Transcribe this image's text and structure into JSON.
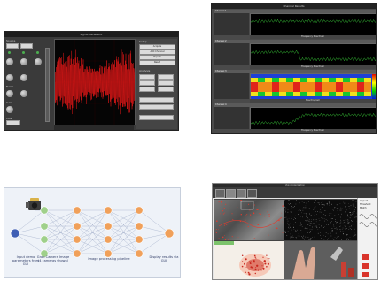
{
  "signal_generator": {
    "title": "Signal Generator",
    "left_labels": [
      "Source",
      "Noise",
      "Gain",
      "Filter"
    ],
    "right_buttons": [
      "Acquire",
      "Add Channel",
      "Export",
      "Reset"
    ],
    "right_headers": [
      "Setup",
      "Analysis"
    ],
    "colors": {
      "background": "#3a3a3a",
      "trace": "#ff1a1a",
      "panel": "#454545"
    }
  },
  "channel_results": {
    "title": "Channel Results",
    "rows": [
      {
        "header": "Channel 1",
        "caption": "Frequency Spectrum"
      },
      {
        "header": "Channel 2",
        "caption": "Frequency Spectrum"
      },
      {
        "header": "Channel 3",
        "caption": "Spectrogram"
      },
      {
        "header": "Channel 4",
        "caption": "Frequency Spectrum"
      }
    ],
    "colors": {
      "trace": "#3ddc3d",
      "background": "#4a4a4a"
    }
  },
  "pipeline": {
    "labels": {
      "input": "Input demo parameters from GUI",
      "grab": "Grab Camera Image (4 cameras shown)",
      "process": "Image processing pipeline",
      "display": "Display results via GUI"
    },
    "colors": {
      "input": "#3f5fb5",
      "stage": "#9fd08a",
      "node": "#f0a05a",
      "background": "#eef2f8"
    }
  },
  "vision_app": {
    "title": "Vision Application",
    "side_labels": [
      "Inspect",
      "Threshold",
      "Match"
    ],
    "colors": {
      "frame": "#3a3a3a",
      "accent": "#d9342b"
    }
  }
}
